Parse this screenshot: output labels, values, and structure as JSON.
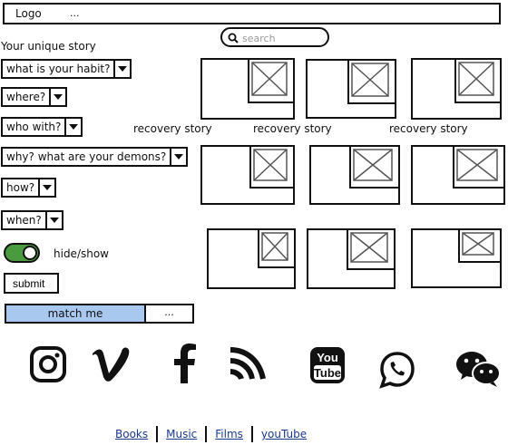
{
  "header": {
    "logo": "Logo",
    "more": "..."
  },
  "sidebar": {
    "title": "Your unique story",
    "dropdowns": [
      {
        "label": "what is your habit?"
      },
      {
        "label": "where?"
      },
      {
        "label": "who with?"
      },
      {
        "label": "why? what are your demons?"
      },
      {
        "label": "how?"
      },
      {
        "label": "when?"
      }
    ],
    "toggle_label": "hide/show",
    "submit_label": "submit",
    "match_label": "match me",
    "match_more": "..."
  },
  "search": {
    "placeholder": "search"
  },
  "gallery": {
    "captions": [
      "recovery story",
      "recovery story",
      "recovery story"
    ]
  },
  "social": [
    "instagram-icon",
    "vimeo-icon",
    "facebook-icon",
    "rss-icon",
    "youtube-icon",
    "whatsapp-icon",
    "wechat-icon"
  ],
  "footer": {
    "links": [
      "Books",
      "Music",
      "Films",
      "youTube"
    ]
  },
  "colors": {
    "toggle_on": "#4a9b3f",
    "match_fill": "#a9c8f0",
    "link": "#1a3a8f"
  }
}
